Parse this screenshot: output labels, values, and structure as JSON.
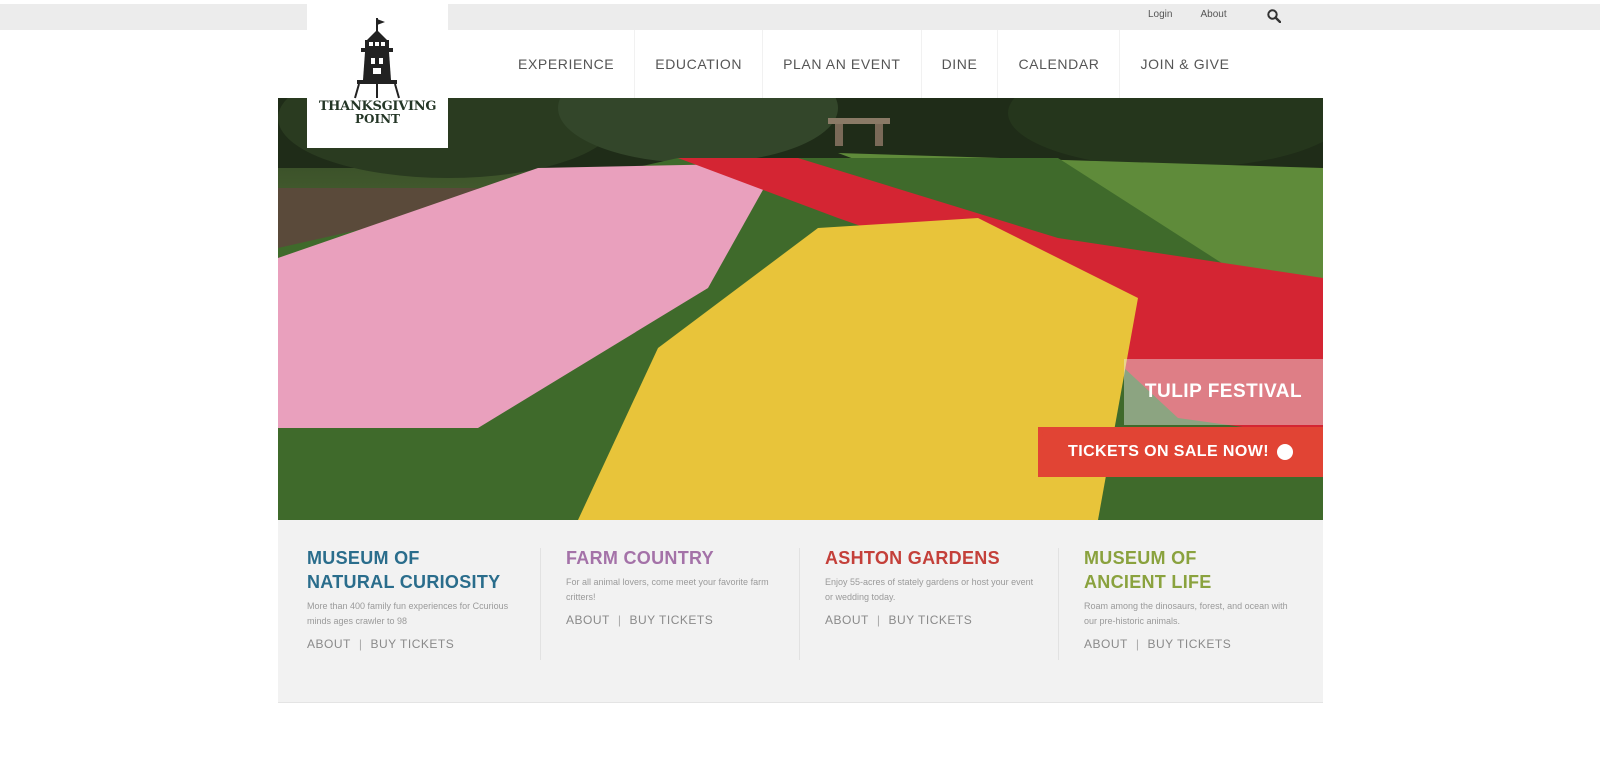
{
  "utility": {
    "login": "Login",
    "about": "About",
    "search_icon": "search-icon"
  },
  "logo": {
    "line1": "THANKSGIVING",
    "line2": "POINT"
  },
  "nav": [
    {
      "label": "EXPERIENCE"
    },
    {
      "label": "EDUCATION"
    },
    {
      "label": "PLAN AN EVENT"
    },
    {
      "label": "DINE"
    },
    {
      "label": "CALENDAR"
    },
    {
      "label": "JOIN & GIVE"
    }
  ],
  "hero": {
    "festival": "TULIP FESTIVAL",
    "cta": "TICKETS ON SALE NOW!",
    "cta_color": "#e14434"
  },
  "cards": [
    {
      "title_line1": "MUSEUM OF",
      "title_line2": "NATURAL CURIOSITY",
      "color": "#2a6d8c",
      "desc": "More than 400 family fun experiences for Ccurious minds ages crawler to 98",
      "about": "ABOUT",
      "sep": "|",
      "buy": "BUY TICKETS"
    },
    {
      "title_line1": "FARM COUNTRY",
      "title_line2": "",
      "color": "#a472a8",
      "desc": "For all animal lovers, come meet your favorite farm critters!",
      "about": "ABOUT",
      "sep": "|",
      "buy": "BUY TICKETS"
    },
    {
      "title_line1": "ASHTON GARDENS",
      "title_line2": "",
      "color": "#c4403a",
      "desc": "Enjoy 55-acres of stately gardens or host your event or wedding today.",
      "about": "ABOUT",
      "sep": "|",
      "buy": "BUY TICKETS"
    },
    {
      "title_line1": "MUSEUM OF",
      "title_line2": "ANCIENT LIFE",
      "color": "#8aa23e",
      "desc": "Roam among the dinosaurs, forest, and ocean with our pre-historic animals.",
      "about": "ABOUT",
      "sep": "|",
      "buy": "BUY TICKETS"
    }
  ]
}
